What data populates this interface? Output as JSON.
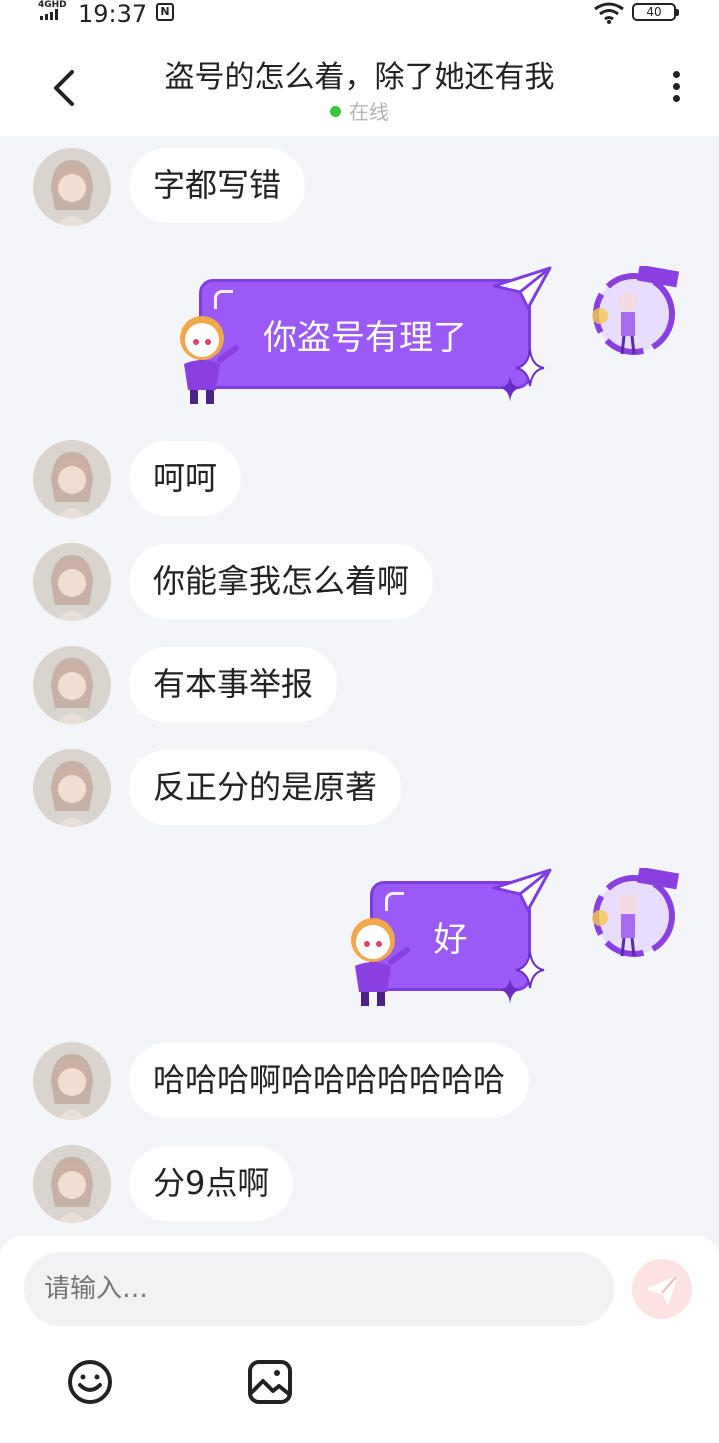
{
  "status_bar": {
    "network": "4GHD",
    "time": "19:37",
    "battery": "40"
  },
  "header": {
    "title": "盗号的怎么着，除了她还有我",
    "status": "在线"
  },
  "messages": [
    {
      "side": "left",
      "text": "字都写错"
    },
    {
      "side": "right",
      "text": "你盗号有理了"
    },
    {
      "side": "left",
      "text": "呵呵"
    },
    {
      "side": "left",
      "text": "你能拿我怎么着啊"
    },
    {
      "side": "left",
      "text": "有本事举报"
    },
    {
      "side": "left",
      "text": "反正分的是原著"
    },
    {
      "side": "right",
      "text": "好"
    },
    {
      "side": "left",
      "text": "哈哈哈啊哈哈哈哈哈哈哈"
    },
    {
      "side": "left",
      "text": "分9点啊"
    }
  ],
  "composer": {
    "placeholder": "请输入…"
  },
  "colors": {
    "accent_purple": "#9b5af5",
    "online_green": "#3cc43c",
    "send_pink": "#fde4e2"
  },
  "icons": [
    "back-icon",
    "more-icon",
    "send-icon",
    "emoji-icon",
    "image-icon"
  ]
}
